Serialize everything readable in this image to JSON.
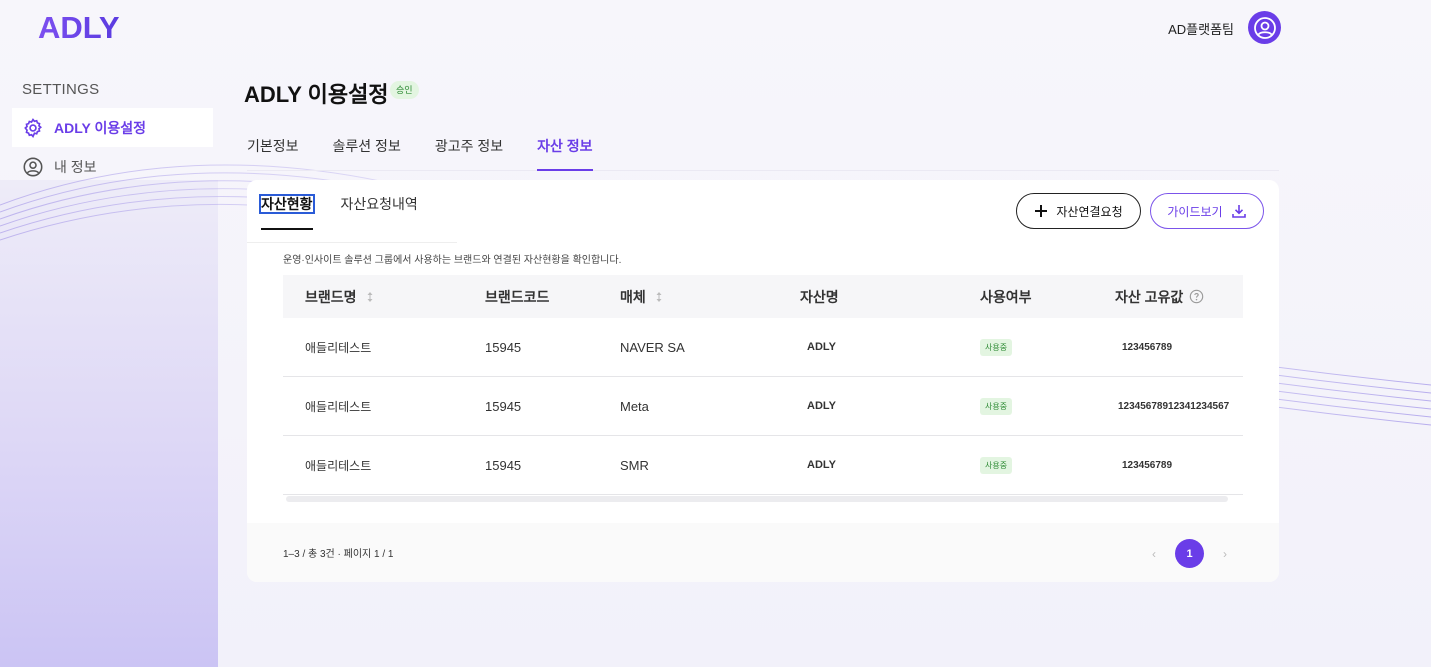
{
  "brand": {
    "logo_text": "ADLY",
    "accent": "#6a3de8"
  },
  "header": {
    "user_name": "AD플랫폼팀"
  },
  "sidebar": {
    "title": "SETTINGS",
    "items": [
      {
        "label": "ADLY 이용설정",
        "icon": "gear-icon",
        "active": true
      },
      {
        "label": "내 정보",
        "icon": "user-circle-icon",
        "active": false
      }
    ]
  },
  "page": {
    "title": "ADLY 이용설정",
    "status_badge": "승인"
  },
  "tabs": [
    {
      "label": "기본정보"
    },
    {
      "label": "솔루션 정보"
    },
    {
      "label": "광고주 정보"
    },
    {
      "label": "자산 정보",
      "active": true
    }
  ],
  "subtabs": [
    {
      "label": "자산현황",
      "active": true
    },
    {
      "label": "자산요청내역"
    }
  ],
  "buttons": {
    "request": "자산연결요청",
    "guide": "가이드보기"
  },
  "description": "운영·인사이트 솔루션 그룹에서 사용하는 브랜드와 연결된 자산현황을 확인합니다.",
  "table": {
    "headers": [
      "브랜드명",
      "브랜드코드",
      "매체",
      "자산명",
      "사용여부",
      "자산 고유값"
    ],
    "rows": [
      {
        "brand": "애들리테스트",
        "code": "15945",
        "media": "NAVER SA",
        "asset": "ADLY",
        "use": "사용중",
        "uid": "123456789"
      },
      {
        "brand": "애들리테스트",
        "code": "15945",
        "media": "Meta",
        "asset": "ADLY",
        "use": "사용중",
        "uid": "12345678912341234567"
      },
      {
        "brand": "애들리테스트",
        "code": "15945",
        "media": "SMR",
        "asset": "ADLY",
        "use": "사용중",
        "uid": "123456789"
      }
    ]
  },
  "pagination": {
    "range_text": "1–3 / 총 3건 · 페이지 1 / 1",
    "current": "1",
    "prev": "‹",
    "next": "›"
  }
}
